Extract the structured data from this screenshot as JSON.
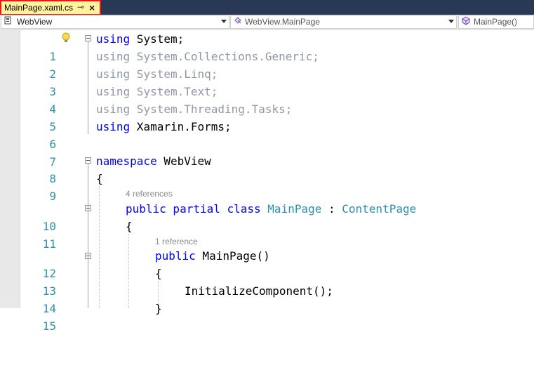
{
  "tab": {
    "label": "MainPage.xaml.cs",
    "pin_glyph": "⊸",
    "close_glyph": "×"
  },
  "navbar": {
    "project": "WebView",
    "type": "WebView.MainPage",
    "member": "MainPage()"
  },
  "icons": {
    "project": "project-icon",
    "type": "class-icon",
    "member": "method-icon",
    "lightbulb": "lightbulb-icon"
  },
  "codelens": {
    "class_refs": "4 references",
    "ctor_refs": "1 reference"
  },
  "code": {
    "l1": {
      "num": "1",
      "kw": "using",
      "rest": " System;"
    },
    "l2": {
      "num": "2",
      "kw": "using",
      "rest": " System.Collections.Generic;"
    },
    "l3": {
      "num": "3",
      "kw": "using",
      "rest": " System.Linq;"
    },
    "l4": {
      "num": "4",
      "kw": "using",
      "rest": " System.Text;"
    },
    "l5": {
      "num": "5",
      "kw": "using",
      "rest": " System.Threading.Tasks;"
    },
    "l6": {
      "num": "6",
      "kw": "using",
      "rest": " Xamarin.Forms;"
    },
    "l7": {
      "num": "7"
    },
    "l8": {
      "num": "8",
      "kw": "namespace",
      "rest": " WebView"
    },
    "l9": {
      "num": "9",
      "rest": "{"
    },
    "l10": {
      "num": "10",
      "kw": "public partial class",
      "type1": "MainPage",
      "colon": " : ",
      "type2": "ContentPage"
    },
    "l11": {
      "num": "11",
      "rest": "{"
    },
    "l12": {
      "num": "12",
      "kw": "public",
      "rest": " MainPage()"
    },
    "l13": {
      "num": "13",
      "rest": "{"
    },
    "l14": {
      "num": "14",
      "rest": "InitializeComponent();"
    },
    "l15": {
      "num": "15",
      "rest": "}"
    }
  },
  "colors": {
    "tab_bg": "#fff29d",
    "highlight_border": "#e21c1c",
    "keyword": "#0000ff",
    "type": "#2b91af",
    "line_number": "#2b91af",
    "dimmed": "#8f98a5",
    "chrome": "#293955"
  }
}
